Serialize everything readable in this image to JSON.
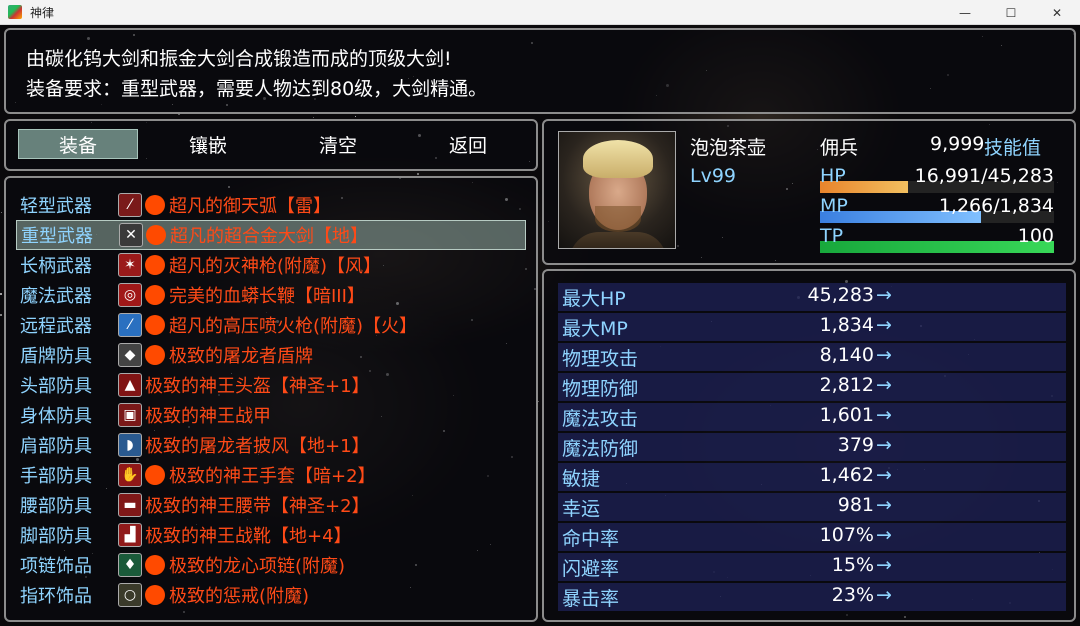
{
  "window": {
    "title": "神律",
    "minimize": "—",
    "maximize": "☐",
    "close": "✕"
  },
  "description": {
    "line1": "由碳化钨大剑和振金大剑合成锻造而成的顶级大剑!",
    "line2": "装备要求：重型武器，需要人物达到80级，大剑精通。"
  },
  "menu": {
    "items": [
      {
        "label": "装备",
        "active": true
      },
      {
        "label": "镶嵌",
        "active": false
      },
      {
        "label": "清空",
        "active": false
      },
      {
        "label": "返回",
        "active": false
      }
    ]
  },
  "equipment": [
    {
      "slot": "轻型武器",
      "icon": "sword-icon",
      "dot": true,
      "name": "超凡的御天弧【雷】"
    },
    {
      "slot": "重型武器",
      "icon": "greatsword-icon",
      "dot": true,
      "name": "超凡的超合金大剑【地】",
      "selected": true
    },
    {
      "slot": "长柄武器",
      "icon": "spear-icon",
      "dot": true,
      "name": "超凡的灭神枪(附魔)【风】"
    },
    {
      "slot": "魔法武器",
      "icon": "whip-icon",
      "dot": true,
      "name": "完美的血蟒长鞭【暗III】"
    },
    {
      "slot": "远程武器",
      "icon": "gun-icon",
      "dot": true,
      "name": "超凡的高压喷火枪(附魔)【火】"
    },
    {
      "slot": "盾牌防具",
      "icon": "shield-icon",
      "dot": true,
      "name": "极致的屠龙者盾牌"
    },
    {
      "slot": "头部防具",
      "icon": "helmet-icon",
      "dot": false,
      "name": "极致的神王头盔【神圣+1】"
    },
    {
      "slot": "身体防具",
      "icon": "armor-icon",
      "dot": false,
      "name": "极致的神王战甲"
    },
    {
      "slot": "肩部防具",
      "icon": "cape-icon",
      "dot": false,
      "name": "极致的屠龙者披风【地+1】"
    },
    {
      "slot": "手部防具",
      "icon": "gauntlet-icon",
      "dot": true,
      "name": "极致的神王手套【暗+2】"
    },
    {
      "slot": "腰部防具",
      "icon": "belt-icon",
      "dot": false,
      "name": "极致的神王腰带【神圣+2】"
    },
    {
      "slot": "脚部防具",
      "icon": "boots-icon",
      "dot": false,
      "name": "极致的神王战靴【地+4】"
    },
    {
      "slot": "项链饰品",
      "icon": "necklace-icon",
      "dot": true,
      "name": "极致的龙心项链(附魔)"
    },
    {
      "slot": "指环饰品",
      "icon": "ring-icon",
      "dot": true,
      "name": "极致的惩戒(附魔)"
    }
  ],
  "actor": {
    "name": "泡泡茶壶",
    "level": "Lv99",
    "class": "佣兵",
    "skill_points": "9,999",
    "skill_points_label": "技能值",
    "hp_label": "HP",
    "hp_text": "16,991/45,283",
    "hp_ratio": 0.375,
    "mp_label": "MP",
    "mp_text": "1,266/1,834",
    "mp_ratio": 0.69,
    "tp_label": "TP",
    "tp_text": "100",
    "tp_ratio": 1.0
  },
  "stats": [
    {
      "label": "最大HP",
      "value": "45,283",
      "arrow": "→"
    },
    {
      "label": "最大MP",
      "value": "1,834",
      "arrow": "→"
    },
    {
      "label": "物理攻击",
      "value": "8,140",
      "arrow": "→"
    },
    {
      "label": "物理防御",
      "value": "2,812",
      "arrow": "→"
    },
    {
      "label": "魔法攻击",
      "value": "1,601",
      "arrow": "→"
    },
    {
      "label": "魔法防御",
      "value": "379",
      "arrow": "→"
    },
    {
      "label": "敏捷",
      "value": "1,462",
      "arrow": "→"
    },
    {
      "label": "幸运",
      "value": "981",
      "arrow": "→"
    },
    {
      "label": "命中率",
      "value": "107%",
      "arrow": "→"
    },
    {
      "label": "闪避率",
      "value": "15%",
      "arrow": "→"
    },
    {
      "label": "暴击率",
      "value": "23%",
      "arrow": "→"
    }
  ],
  "colors": {
    "system_blue": "#8fd4ff",
    "item_orange": "#ff4a17",
    "hp_start": "#e8842c",
    "hp_end": "#f2c060",
    "mp_start": "#3a7fe0",
    "mp_end": "#80c0ff",
    "tp_start": "#18a83c",
    "tp_end": "#38d858"
  }
}
